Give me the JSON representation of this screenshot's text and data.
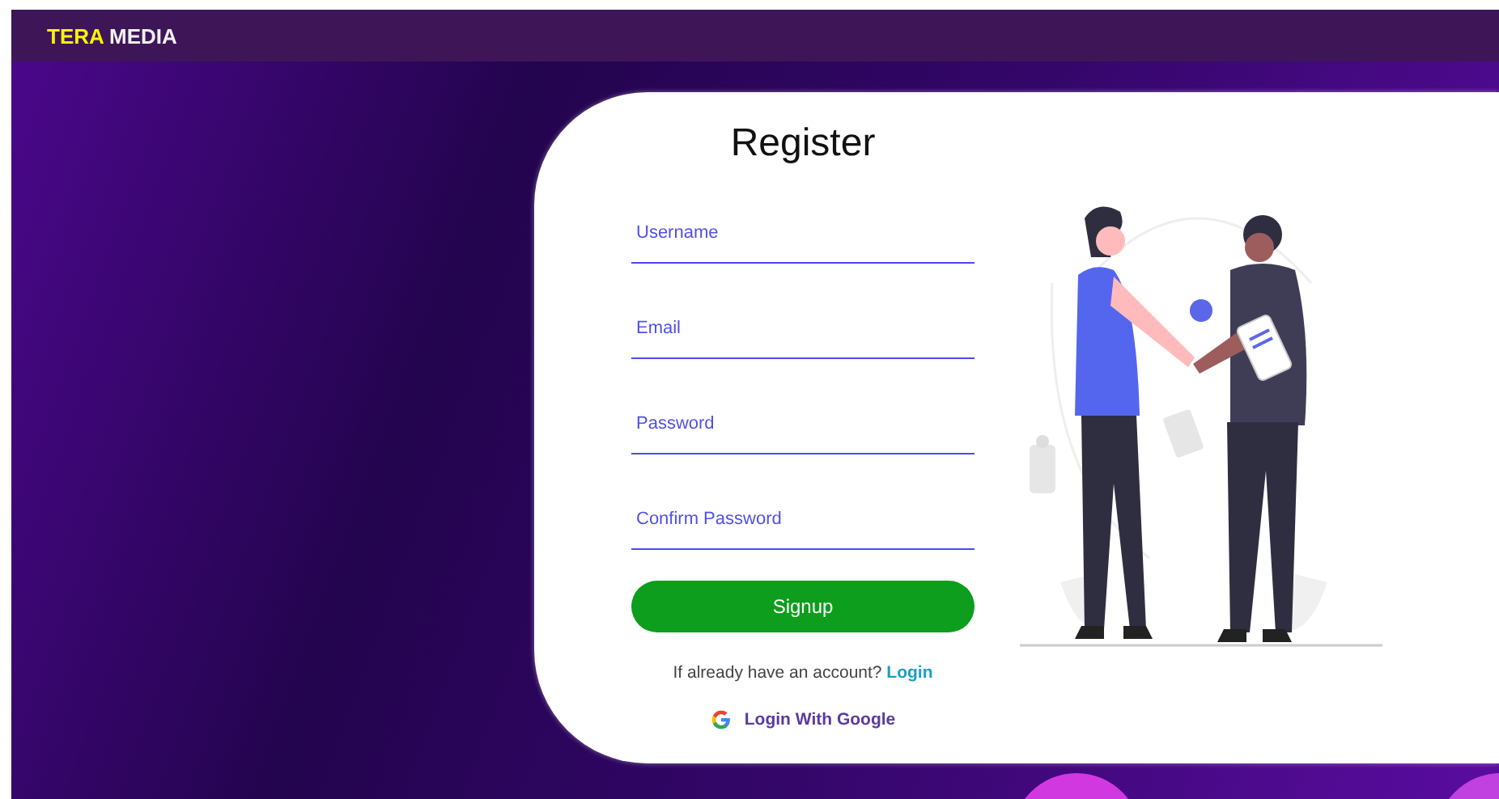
{
  "navbar": {
    "brand_first": "TERA",
    "brand_second": "MEDIA"
  },
  "form": {
    "title": "Register",
    "fields": [
      {
        "placeholder": "Username"
      },
      {
        "placeholder": "Email"
      },
      {
        "placeholder": "Password"
      },
      {
        "placeholder": "Confirm Password"
      }
    ],
    "submit": "Signup",
    "login_prompt": "If already have an account?",
    "login_link": "Login",
    "google_login": "Login With Google"
  }
}
